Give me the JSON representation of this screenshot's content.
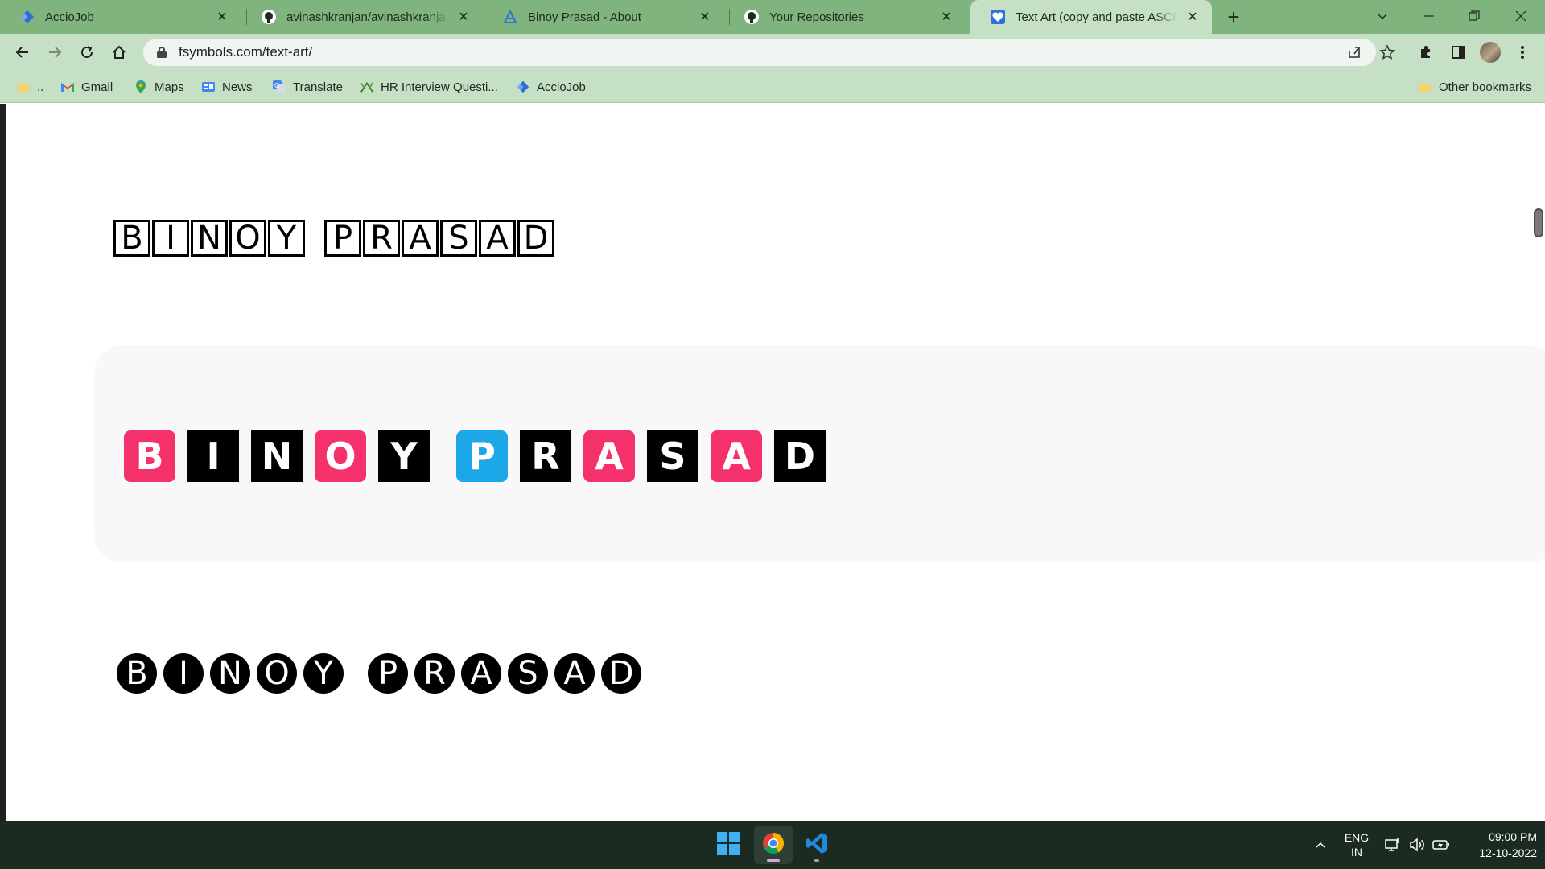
{
  "browser": {
    "tabs": [
      {
        "title": "AccioJob",
        "icon": "acciojob-icon",
        "active": false
      },
      {
        "title": "avinashkranjan/avinashkranjan.github.io",
        "icon": "github-icon",
        "active": false
      },
      {
        "title": "Binoy Prasad - About",
        "icon": "site-logo-icon",
        "active": false
      },
      {
        "title": "Your Repositories",
        "icon": "github-icon",
        "active": false
      },
      {
        "title": "Text Art (copy and paste ASCII pictures)",
        "icon": "heart-icon",
        "active": true
      }
    ],
    "new_tab_label": "+",
    "address": {
      "url": "fsymbols.com/text-art/"
    },
    "bookmarks": [
      {
        "label": "..",
        "icon": "folder-icon"
      },
      {
        "label": "Gmail",
        "icon": "gmail-icon"
      },
      {
        "label": "Maps",
        "icon": "maps-icon"
      },
      {
        "label": "News",
        "icon": "news-icon"
      },
      {
        "label": "Translate",
        "icon": "translate-icon"
      },
      {
        "label": "HR Interview Questi...",
        "icon": "plant-icon"
      },
      {
        "label": "AccioJob",
        "icon": "acciojob-icon"
      }
    ],
    "other_bookmarks": "Other bookmarks"
  },
  "page": {
    "art_outline": {
      "word1": [
        "B",
        "I",
        "N",
        "O",
        "Y"
      ],
      "word2": [
        "P",
        "R",
        "A",
        "S",
        "A",
        "D"
      ]
    },
    "art_filled": {
      "word1": [
        {
          "ch": "B",
          "color": "#f5316b"
        },
        {
          "ch": "I",
          "color": "#000000"
        },
        {
          "ch": "N",
          "color": "#000000"
        },
        {
          "ch": "O",
          "color": "#f5316b"
        },
        {
          "ch": "Y",
          "color": "#000000"
        }
      ],
      "word2": [
        {
          "ch": "P",
          "color": "#1ba7e8"
        },
        {
          "ch": "R",
          "color": "#000000"
        },
        {
          "ch": "A",
          "color": "#f5316b"
        },
        {
          "ch": "S",
          "color": "#000000"
        },
        {
          "ch": "A",
          "color": "#f5316b"
        },
        {
          "ch": "D",
          "color": "#000000"
        }
      ]
    },
    "art_circled": {
      "word1": [
        "B",
        "I",
        "N",
        "O",
        "Y"
      ],
      "word2": [
        "P",
        "R",
        "A",
        "S",
        "A",
        "D"
      ]
    }
  },
  "taskbar": {
    "apps": [
      {
        "name": "windows-start",
        "icon": "windows-icon"
      },
      {
        "name": "chrome",
        "icon": "chrome-icon"
      },
      {
        "name": "vscode",
        "icon": "vscode-icon"
      }
    ],
    "language": {
      "line1": "ENG",
      "line2": "IN"
    },
    "time": "09:00 PM",
    "date": "12-10-2022"
  }
}
